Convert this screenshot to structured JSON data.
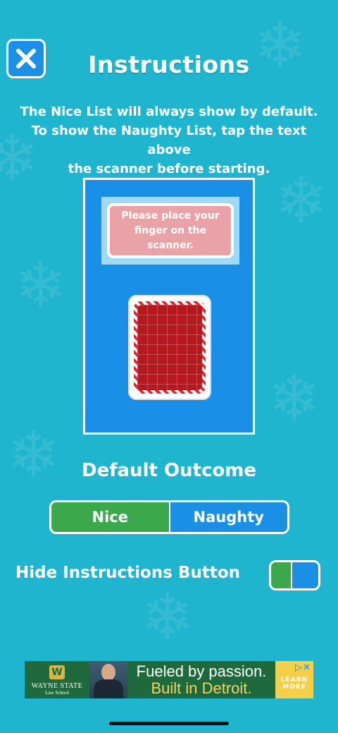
{
  "header": {
    "close_icon": "close-x-icon",
    "title": "Instructions"
  },
  "description": {
    "line1": "The Nice List will always show by default.",
    "line2": "To show the Naughty List, tap the text above",
    "line3": "the scanner before starting."
  },
  "preview": {
    "message": "Please place your finger on the scanner.",
    "scanner_icon": "fingerprint-scanner-pad"
  },
  "default_outcome": {
    "label": "Default Outcome",
    "options": [
      "Nice",
      "Naughty"
    ],
    "selected": "Naughty"
  },
  "hide_instructions": {
    "label": "Hide Instructions Button"
  },
  "ad": {
    "brand": "WAYNE STATE",
    "sub": "Law School",
    "line1": "Fueled by passion.",
    "line2": "Built in Detroit.",
    "cta": "LEARN MORE"
  },
  "colors": {
    "background": "#1fb5cf",
    "accent_blue": "#1b8fe6",
    "accent_green": "#3aa84b",
    "message_pink": "#e9a3a6",
    "scanner_red": "#b3191f"
  }
}
